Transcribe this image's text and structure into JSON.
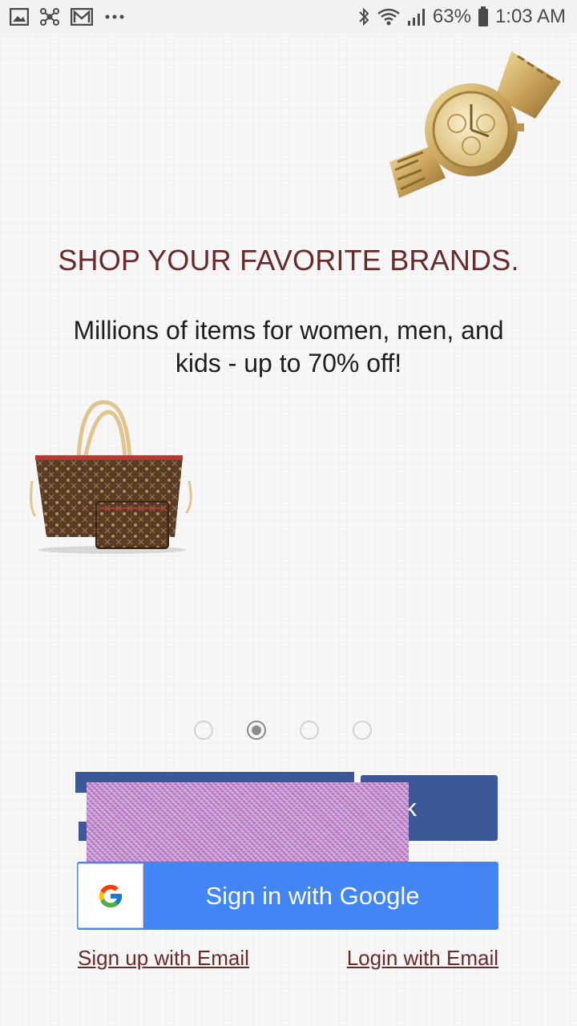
{
  "status_bar": {
    "battery_percent": "63%",
    "time": "1:03 AM",
    "left_icons": [
      "gallery-icon",
      "network-icon",
      "mail-icon",
      "more-dots-icon"
    ],
    "right_icons": [
      "bluetooth-icon",
      "wifi-icon",
      "signal-icon",
      "battery-icon"
    ]
  },
  "onboarding": {
    "headline": "SHOP YOUR FAVORITE BRANDS.",
    "subline": "Millions of items for women, men, and kids - up to 70% off!",
    "pager": {
      "total": 4,
      "active_index": 1
    }
  },
  "auth": {
    "facebook_visible_text": "ook",
    "google_label": "Sign in with Google",
    "signup_email": "Sign up with Email",
    "login_email": "Login with Email"
  },
  "colors": {
    "accent": "#6b2a2a",
    "facebook": "#3b5998",
    "google": "#4285f4"
  }
}
